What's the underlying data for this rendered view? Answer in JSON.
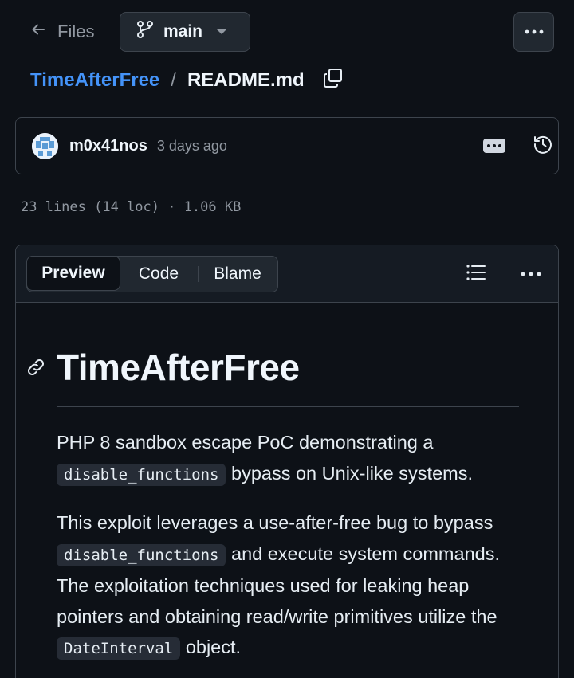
{
  "topbar": {
    "back_label": "Files",
    "branch_label": "main"
  },
  "breadcrumb": {
    "repo": "TimeAfterFree",
    "separator": "/",
    "file": "README.md"
  },
  "commit": {
    "author": "m0x41nos",
    "time": "3 days ago"
  },
  "file_meta": {
    "text": "23 lines (14 loc) · 1.06 KB"
  },
  "viewer": {
    "tabs": [
      {
        "label": "Preview",
        "active": true
      },
      {
        "label": "Code",
        "active": false
      },
      {
        "label": "Blame",
        "active": false
      }
    ]
  },
  "readme": {
    "title": "TimeAfterFree",
    "p1_a": "PHP 8 sandbox escape PoC demonstrating a",
    "p1_code": "disable_functions",
    "p1_b": "bypass on Unix-like systems.",
    "p2_a": "This exploit leverages a use-after-free bug to bypass",
    "p2_code1": "disable_functions",
    "p2_b": "and execute system commands. The exploitation techniques used for leaking heap pointers and obtaining read/write primitives utilize the",
    "p2_code2": "DateInterval",
    "p2_c": "object."
  },
  "colors": {
    "background": "#0d1117",
    "link": "#4493f8",
    "border": "#3d444d",
    "muted": "#9198a1"
  },
  "icons": [
    "arrow-left-icon",
    "git-branch-icon",
    "chevron-down-icon",
    "kebab-horizontal-icon",
    "copy-icon",
    "avatar-identicon",
    "ellipsis-badge-icon",
    "history-icon",
    "list-unordered-icon",
    "link-icon"
  ]
}
